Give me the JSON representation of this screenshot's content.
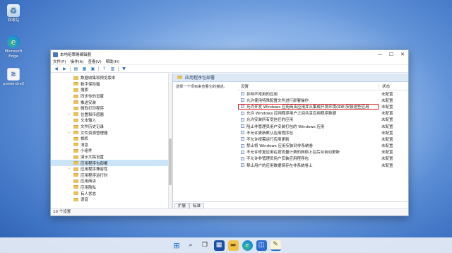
{
  "desktop": {
    "icons": [
      {
        "label": "回收站",
        "icon": "recycle-bin-icon"
      },
      {
        "label": "Microsoft Edge",
        "icon": "edge-icon"
      },
      {
        "label": "powershell",
        "icon": "powershell-icon"
      }
    ]
  },
  "window": {
    "title": "本地组策略编辑器",
    "controls": {
      "minimize": "—",
      "maximize": "☐",
      "close": "✕"
    },
    "menu": [
      "文件(F)",
      "操作(A)",
      "查看(V)",
      "帮助(H)"
    ],
    "toolbar_icons": [
      "back-icon",
      "forward-icon",
      "up-icon",
      "show-hide-tree-icon",
      "export-icon",
      "help-icon",
      "view-icon",
      "filter-icon"
    ],
    "tree": [
      {
        "label": "数据收集和预览版本",
        "expandable": false
      },
      {
        "label": "数字保险箱",
        "expandable": false
      },
      {
        "label": "搜索",
        "expandable": false
      },
      {
        "label": "同步你的设置",
        "expandable": false
      },
      {
        "label": "推送安装",
        "expandable": false
      },
      {
        "label": "微软打印程序",
        "expandable": false
      },
      {
        "label": "位置和传感器",
        "expandable": true
      },
      {
        "label": "文本输入",
        "expandable": false
      },
      {
        "label": "文件历史记录",
        "expandable": false
      },
      {
        "label": "文件资源管理器",
        "expandable": true
      },
      {
        "label": "相机",
        "expandable": false
      },
      {
        "label": "消息",
        "expandable": false
      },
      {
        "label": "小组件",
        "expandable": false
      },
      {
        "label": "演示文稿设置",
        "expandable": false
      },
      {
        "label": "应用程序包部署",
        "expandable": false,
        "selected": true
      },
      {
        "label": "应用程序兼容性",
        "expandable": true
      },
      {
        "label": "应用程序运行时",
        "expandable": false
      },
      {
        "label": "应用商店",
        "expandable": false
      },
      {
        "label": "应用隐私",
        "expandable": false
      },
      {
        "label": "有人状态",
        "expandable": false
      },
      {
        "label": "语音",
        "expandable": false
      }
    ],
    "right_header": "应用程序包部署",
    "description": "选择一个项目来查看它的描述。",
    "columns": {
      "setting": "设置",
      "state": "状态"
    },
    "rows": [
      {
        "setting": "存档不常用的应用",
        "state": "未配置"
      },
      {
        "setting": "允许使用特殊配置文件进行部署操作",
        "state": "未配置"
      },
      {
        "setting": "允许开发 Windows 应用商店应用并从集成开发环境(IDE)安装这些应用",
        "state": "未配置",
        "highlighted": true
      },
      {
        "setting": "允许 Windows 应用程序用户之间共享应用程序数据",
        "state": "未配置"
      },
      {
        "setting": "允许安装所有受信任的应用",
        "state": "未配置"
      },
      {
        "setting": "阻止非管理员用户安装打包的 Windows 应用",
        "state": "未配置"
      },
      {
        "setting": "不允许更新默认应用程序包",
        "state": "未配置"
      },
      {
        "setting": "不允许按需运行应用更新",
        "state": "未配置"
      },
      {
        "setting": "禁止将 Windows 应用安装到非系统卷",
        "state": "未配置"
      },
      {
        "setting": "不允许修复应用在按流量计费的网络上在后台自动更新",
        "state": "未配置"
      },
      {
        "setting": "不允许非管理员用户安装应用程序包",
        "state": "未配置"
      },
      {
        "setting": "禁止用户的应用数据保存在非系统卷上",
        "state": "未配置"
      }
    ],
    "tabs": [
      "扩展",
      "标准"
    ],
    "status": "10 个设置"
  },
  "taskbar": {
    "items": [
      "start-icon",
      "search-icon",
      "task-view-icon",
      "widgets-icon",
      "file-explorer-icon",
      "edge-icon",
      "store-icon",
      "notepad-icon"
    ]
  },
  "colors": {
    "highlight_border": "#e02020",
    "selected_tree": "#cce4f7",
    "header_bg": "#dde8f5"
  }
}
